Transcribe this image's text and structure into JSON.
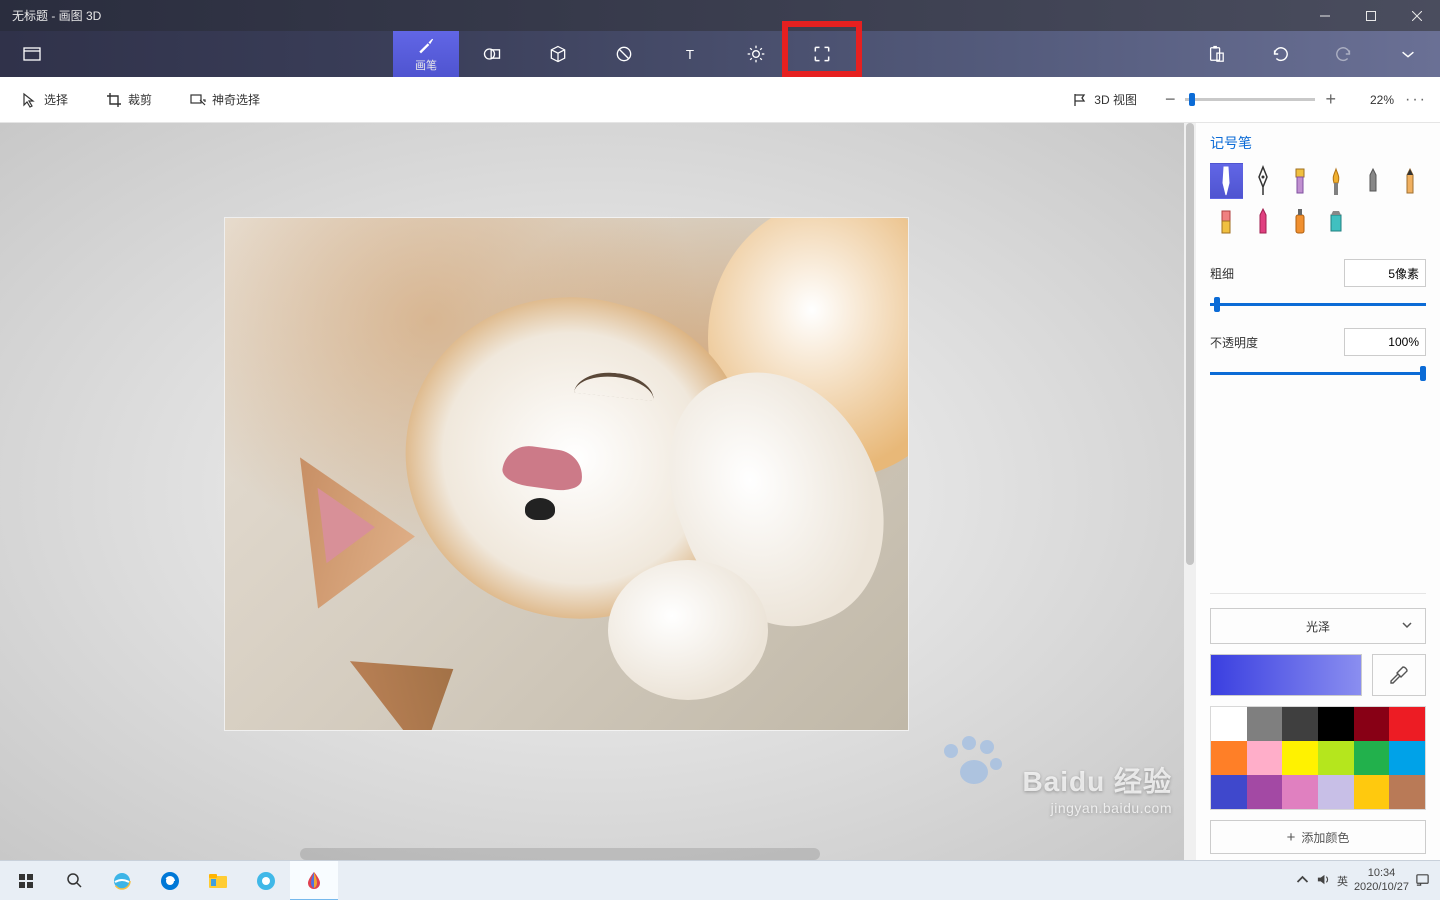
{
  "title": "无标题 - 画图 3D",
  "tabs": {
    "brush": "画笔"
  },
  "subtoolbar": {
    "select": "选择",
    "crop": "裁剪",
    "magic_select": "神奇选择",
    "view3d": "3D 视图",
    "zoom_value": "22%"
  },
  "panel": {
    "title": "记号笔",
    "thickness_label": "粗细",
    "thickness_value": "5像素",
    "opacity_label": "不透明度",
    "opacity_value": "100%",
    "finish_label": "光泽",
    "add_color": "添加颜色",
    "palette": [
      "#ffffff",
      "#7f7f7f",
      "#3f3f3f",
      "#000000",
      "#880015",
      "#ed1c24",
      "#ff7f27",
      "#fff200",
      "#ffaec9",
      "#22b14c",
      "#00a2e8",
      "#a349a4",
      "#c8bfe7",
      "#3f48cc",
      "#b5e61d",
      "#b97a57",
      "#ffc90e",
      "#c3c3c3"
    ]
  },
  "watermark": {
    "brand": "Baidu 经验",
    "url": "jingyan.baidu.com"
  },
  "taskbar": {
    "ime": "英",
    "time": "10:34",
    "date": "2020/10/27"
  }
}
